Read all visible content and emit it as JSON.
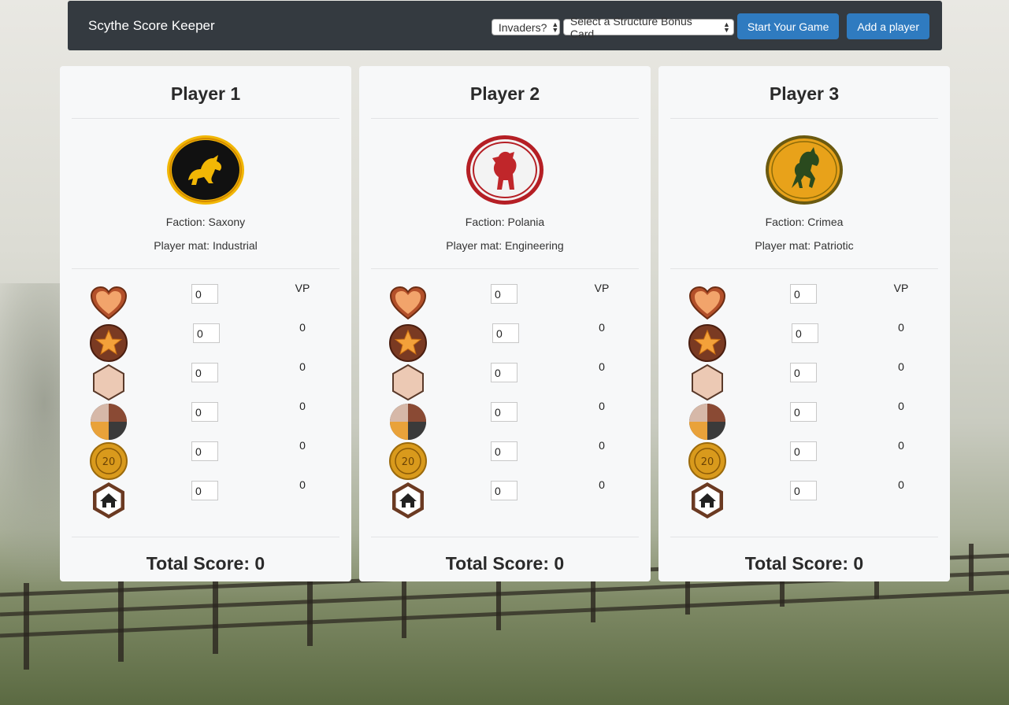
{
  "app": {
    "title": "Scythe Score Keeper"
  },
  "toolbar": {
    "invaders_select": "Invaders?",
    "structure_bonus_select": "Select a Structure Bonus Card",
    "start_button": "Start Your Game",
    "add_player_button": "Add a player"
  },
  "players": [
    {
      "name": "Player 1",
      "faction": "Faction: Saxony",
      "player_mat": "Player mat: Industrial",
      "emblem": "wolf-emblem",
      "emblem_color": "#f2b705",
      "vp_header": "VP",
      "rows": [
        {
          "icon": "popularity-heart-icon",
          "value": "0",
          "vp": ""
        },
        {
          "icon": "star-icon",
          "value": "0",
          "vp": "0"
        },
        {
          "icon": "territory-hex-icon",
          "value": "0",
          "vp": "0"
        },
        {
          "icon": "resources-icon",
          "value": "0",
          "vp": "0"
        },
        {
          "icon": "coin-icon",
          "value": "0",
          "vp": "0"
        },
        {
          "icon": "structure-bonus-icon",
          "value": "0",
          "vp": "0"
        }
      ],
      "total": "Total Score: 0"
    },
    {
      "name": "Player 2",
      "faction": "Faction: Polania",
      "player_mat": "Player mat: Engineering",
      "emblem": "bear-emblem",
      "emblem_color": "#c0262a",
      "vp_header": "VP",
      "rows": [
        {
          "icon": "popularity-heart-icon",
          "value": "0",
          "vp": ""
        },
        {
          "icon": "star-icon",
          "value": "0",
          "vp": "0"
        },
        {
          "icon": "territory-hex-icon",
          "value": "0",
          "vp": "0"
        },
        {
          "icon": "resources-icon",
          "value": "0",
          "vp": "0"
        },
        {
          "icon": "coin-icon",
          "value": "0",
          "vp": "0"
        },
        {
          "icon": "structure-bonus-icon",
          "value": "0",
          "vp": "0"
        }
      ],
      "total": "Total Score: 0"
    },
    {
      "name": "Player 3",
      "faction": "Faction: Crimea",
      "player_mat": "Player mat: Patriotic",
      "emblem": "horse-emblem",
      "emblem_color": "#e8a21a",
      "vp_header": "VP",
      "rows": [
        {
          "icon": "popularity-heart-icon",
          "value": "0",
          "vp": ""
        },
        {
          "icon": "star-icon",
          "value": "0",
          "vp": "0"
        },
        {
          "icon": "territory-hex-icon",
          "value": "0",
          "vp": "0"
        },
        {
          "icon": "resources-icon",
          "value": "0",
          "vp": "0"
        },
        {
          "icon": "coin-icon",
          "value": "0",
          "vp": "0"
        },
        {
          "icon": "structure-bonus-icon",
          "value": "0",
          "vp": "0"
        }
      ],
      "total": "Total Score: 0"
    }
  ]
}
